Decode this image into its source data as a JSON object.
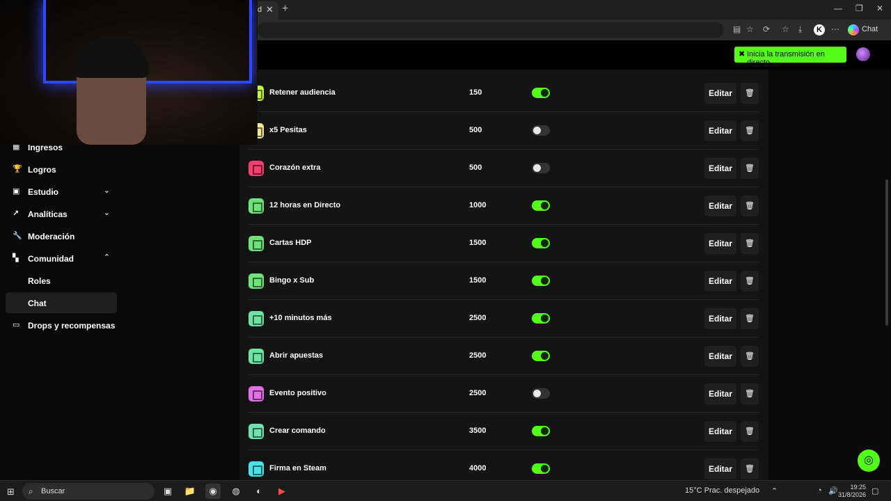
{
  "browser": {
    "tab_title": "d",
    "chat_label": "Chat"
  },
  "header": {
    "live_button_label": "Inicia la transmisión en directo",
    "brand_color": "#53fc18"
  },
  "sidebar": {
    "items": [
      {
        "label": "Ingresos",
        "icon": "bank-icon"
      },
      {
        "label": "Logros",
        "icon": "trophy-icon"
      },
      {
        "label": "Estudio",
        "icon": "studio-icon",
        "chevron": "down"
      },
      {
        "label": "Analíticas",
        "icon": "chart-icon",
        "chevron": "down"
      },
      {
        "label": "Moderación",
        "icon": "wrench-icon"
      },
      {
        "label": "Comunidad",
        "icon": "community-icon",
        "chevron": "up"
      },
      {
        "label": "Roles"
      },
      {
        "label": "Chat",
        "active": true
      },
      {
        "label": "Drops y recompensas",
        "icon": "gift-icon"
      }
    ]
  },
  "rewards": {
    "edit_label": "Editar",
    "rows": [
      {
        "name": "Retener audiencia",
        "cost": "150",
        "enabled": true,
        "color": "#c8f44a"
      },
      {
        "name": "x5 Pesitas",
        "cost": "500",
        "enabled": false,
        "color": "#f4e79a"
      },
      {
        "name": "Corazón extra",
        "cost": "500",
        "enabled": false,
        "color": "#f43f6e"
      },
      {
        "name": "12 horas en Directo",
        "cost": "1000",
        "enabled": true,
        "color": "#6ee37a"
      },
      {
        "name": "Cartas HDP",
        "cost": "1500",
        "enabled": true,
        "color": "#6ee37a"
      },
      {
        "name": "Bingo x Sub",
        "cost": "1500",
        "enabled": true,
        "color": "#6ee37a"
      },
      {
        "name": "+10 minutos más",
        "cost": "2500",
        "enabled": true,
        "color": "#6ee3a0"
      },
      {
        "name": "Abrir apuestas",
        "cost": "2500",
        "enabled": true,
        "color": "#6ee3a0"
      },
      {
        "name": "Evento positivo",
        "cost": "2500",
        "enabled": false,
        "color": "#e46ee8"
      },
      {
        "name": "Crear comando",
        "cost": "3500",
        "enabled": true,
        "color": "#6ee3b0"
      },
      {
        "name": "Firma en Steam",
        "cost": "4000",
        "enabled": true,
        "color": "#4ae3e8"
      }
    ]
  },
  "taskbar": {
    "search_label": "Buscar",
    "weather": "15°C  Prac. despejado",
    "time": "19:25",
    "date": "31/8/2026"
  }
}
